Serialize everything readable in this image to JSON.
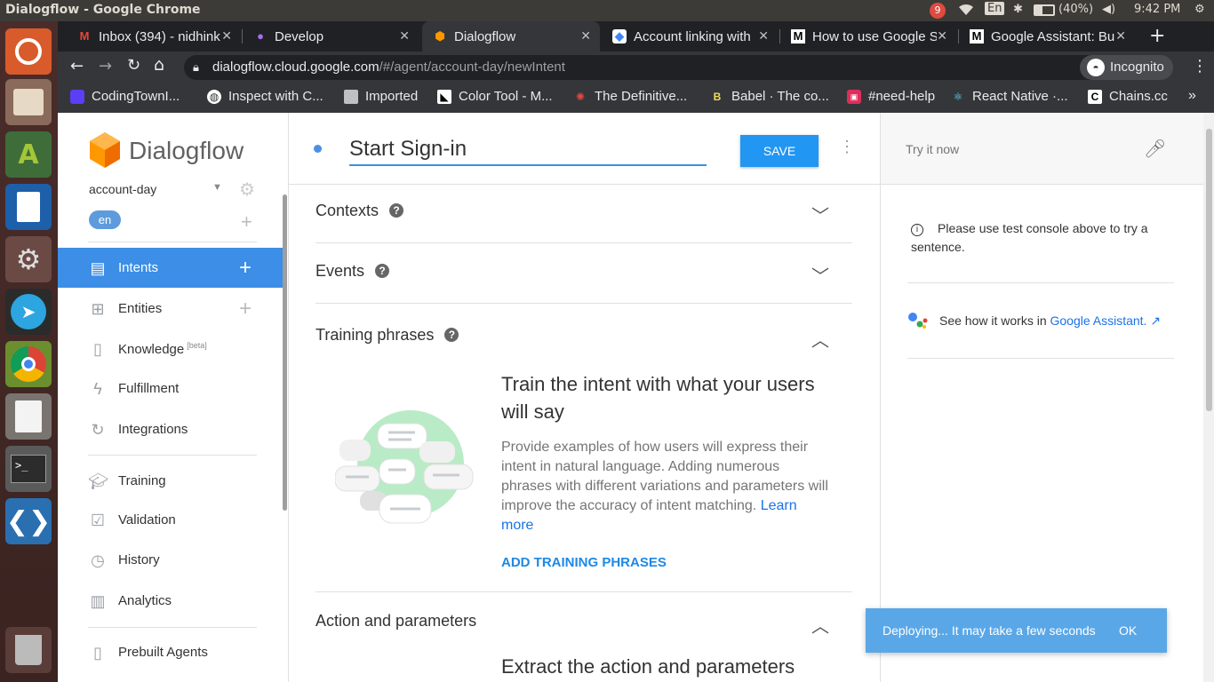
{
  "os": {
    "window_title": "Dialogflow - Google Chrome",
    "notif_count": "9",
    "lang": "En",
    "battery": "(40%)",
    "time": "9:42 PM"
  },
  "browser": {
    "tabs": [
      {
        "label": "Inbox (394) - nidhink",
        "icon": "gmail-icon"
      },
      {
        "label": "Develop",
        "icon": "develop-icon"
      },
      {
        "label": "Dialogflow",
        "icon": "dialogflow-icon"
      },
      {
        "label": "Account linking with",
        "icon": "google-icon"
      },
      {
        "label": "How to use Google S",
        "icon": "medium-icon"
      },
      {
        "label": "Google Assistant: Bu",
        "icon": "medium-icon"
      }
    ],
    "url": "dialogflow.cloud.google.com/#/agent/account-day/newIntent",
    "url_host": "dialogflow.cloud.google.com",
    "url_path": "/#/agent/account-day/newIntent",
    "incognito": "Incognito",
    "bookmarks": [
      "CodingTownI...",
      "Inspect with C...",
      "Imported",
      "Color Tool - M...",
      "The Definitive...",
      "Babel · The co...",
      "#need-help",
      "React Native ·...",
      "Chains.cc"
    ]
  },
  "sidebar": {
    "logo_text": "Dialogflow",
    "agent": "account-day",
    "language": "en",
    "items": [
      {
        "label": "Intents",
        "icon": "intents-icon"
      },
      {
        "label": "Entities",
        "icon": "entities-icon"
      },
      {
        "label": "Knowledge",
        "sup": "[beta]",
        "icon": "knowledge-icon"
      },
      {
        "label": "Fulfillment",
        "icon": "fulfillment-icon"
      },
      {
        "label": "Integrations",
        "icon": "integrations-icon"
      },
      {
        "label": "Training",
        "icon": "training-icon"
      },
      {
        "label": "Validation",
        "icon": "validation-icon"
      },
      {
        "label": "History",
        "icon": "history-icon"
      },
      {
        "label": "Analytics",
        "icon": "analytics-icon"
      },
      {
        "label": "Prebuilt Agents",
        "icon": "prebuilt-agents-icon"
      }
    ]
  },
  "intent": {
    "name": "Start Sign-in",
    "save_label": "SAVE",
    "sections": {
      "contexts": "Contexts",
      "events": "Events",
      "training": "Training phrases",
      "action": "Action and parameters"
    },
    "training_heading": "Train the intent with what your users will say",
    "training_body": "Provide examples of how users will express their intent in natural language. Adding numerous phrases with different variations and parameters will improve the accuracy of intent matching.",
    "learn_more": "Learn more",
    "add_training": "ADD TRAINING PHRASES",
    "action_heading": "Extract the action and parameters"
  },
  "console": {
    "placeholder": "Try it now",
    "info": "Please use test console above to try a sentence.",
    "assistant_prefix": "See how it works in",
    "assistant_link": "Google Assistant."
  },
  "toast": {
    "message": "Deploying... It may take a few seconds",
    "ok": "OK"
  },
  "colors": {
    "accent": "#3c8ee6",
    "save_button": "#2196f3",
    "toast_bg": "#5aa7e8",
    "link": "#1a73e8"
  }
}
